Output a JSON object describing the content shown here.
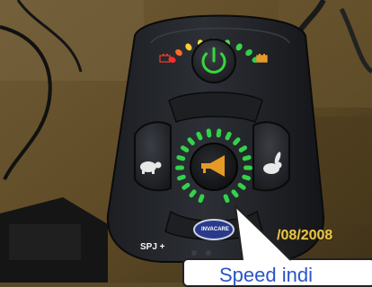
{
  "panel": {
    "model_label": "SPJ +",
    "brand_label": "INVACARE",
    "power_color": "#39d63e",
    "horn_color": "#e49a24",
    "speed_led_color": "#33d24a"
  },
  "battery_gauge": {
    "led_colors": [
      "#ff2a2a",
      "#ff6a2a",
      "#ffcc33",
      "#f0e43a",
      "#9fe03a",
      "#4ed84a",
      "#3cd44a",
      "#2ecf4a",
      "#2ecf4a"
    ],
    "icons": [
      "battery-empty-icon",
      "battery-full-icon"
    ]
  },
  "speed_ring": {
    "leds_total": 20,
    "leds_lit": 20
  },
  "buttons": [
    "power-button",
    "speed-down-button",
    "horn-button",
    "speed-up-button",
    "mode-button"
  ],
  "photo": {
    "date_stamp": "/08/2008"
  },
  "callout": {
    "text": "Speed indi"
  }
}
